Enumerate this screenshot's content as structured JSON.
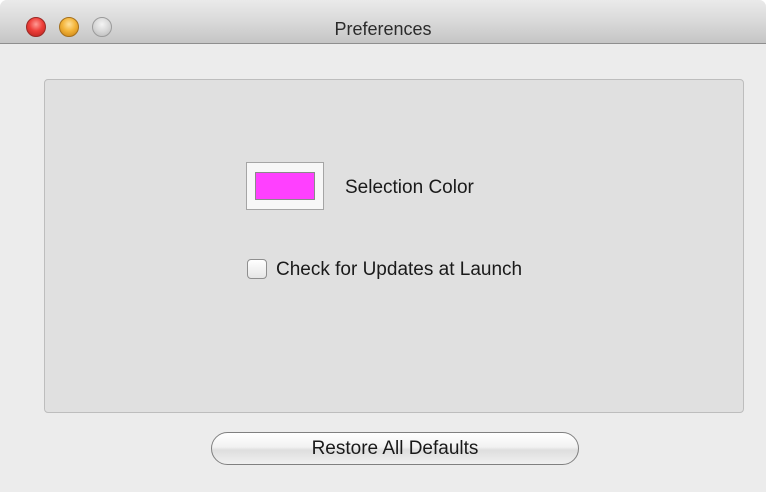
{
  "window": {
    "title": "Preferences"
  },
  "preferences": {
    "selection_color_label": "Selection Color",
    "selection_color": "#ff40ff",
    "check_updates_label": "Check for Updates at Launch",
    "check_updates_checked": false
  },
  "footer": {
    "restore_label": "Restore All Defaults"
  }
}
